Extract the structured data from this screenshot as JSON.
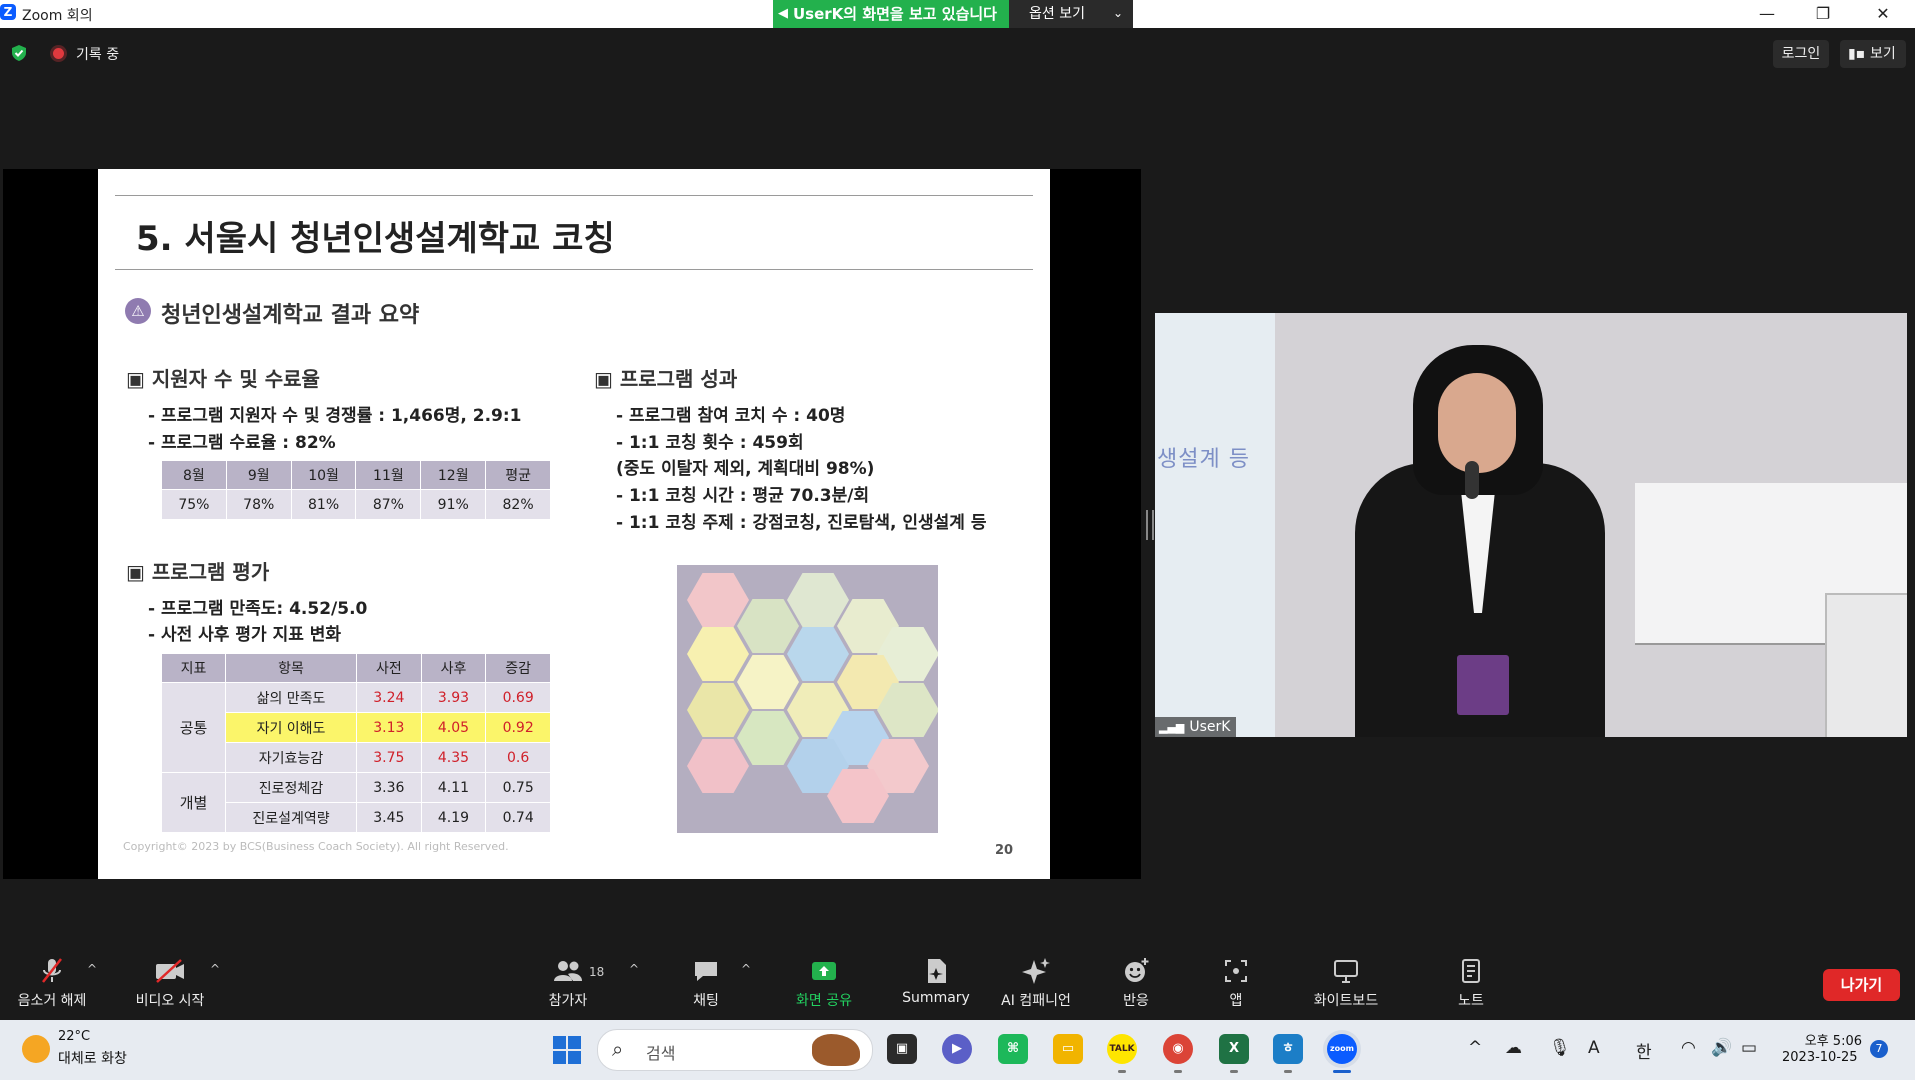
{
  "window": {
    "title": "Zoom 회의",
    "share_banner": "UserK의 화면을 보고 있습니다",
    "view_options": "옵션 보기",
    "controls": [
      "—",
      "❐",
      "✕"
    ]
  },
  "meeting": {
    "recording": "기록 중",
    "login": "로그인",
    "view": "보기"
  },
  "slide": {
    "title": "5. 서울시 청년인생설계학교 코칭",
    "subtitle": "청년인생설계학교 결과 요약",
    "section1": {
      "heading": "▣ 지원자 수 및 수료율",
      "bullets": [
        "- 프로그램 지원자 수 및 경쟁률 : 1,466명, 2.9:1",
        "- 프로그램 수료율 : 82%"
      ],
      "table": {
        "headers": [
          "8월",
          "9월",
          "10월",
          "11월",
          "12월",
          "평균"
        ],
        "values": [
          "75%",
          "78%",
          "81%",
          "87%",
          "91%",
          "82%"
        ]
      }
    },
    "section2": {
      "heading": "▣ 프로그램 성과",
      "bullets": [
        "- 프로그램 참여 코치 수 : 40명",
        "- 1:1 코칭 횟수 : 459회",
        "  (중도 이탈자 제외, 계획대비 98%)",
        "- 1:1 코칭 시간 : 평균 70.3분/회",
        "- 1:1 코칭 주제 : 강점코칭, 진로탐색, 인생설계 등"
      ]
    },
    "section3": {
      "heading": "▣ 프로그램 평가",
      "bullets": [
        "- 프로그램 만족도: 4.52/5.0",
        "- 사전 사후 평가 지표 변화"
      ],
      "table": {
        "headers": [
          "지표",
          "항목",
          "사전",
          "사후",
          "증감"
        ],
        "groups": [
          "공통",
          "개별"
        ],
        "rows": [
          {
            "item": "삶의 만족도",
            "pre": "3.24",
            "post": "3.93",
            "diff": "0.69"
          },
          {
            "item": "자기 이해도",
            "pre": "3.13",
            "post": "4.05",
            "diff": "0.92"
          },
          {
            "item": "자기효능감",
            "pre": "3.75",
            "post": "4.35",
            "diff": "0.6"
          },
          {
            "item": "진로정체감",
            "pre": "3.36",
            "post": "4.11",
            "diff": "0.75"
          },
          {
            "item": "진로설계역량",
            "pre": "3.45",
            "post": "4.19",
            "diff": "0.74"
          }
        ]
      }
    },
    "copyright": "Copyright© 2023 by BCS(Business Coach Society). All right Reserved.",
    "page": "20"
  },
  "video": {
    "name": "UserK",
    "background_sign": "생설계 등"
  },
  "toolbar": {
    "mute": "음소거 해제",
    "video": "비디오 시작",
    "participants": "참가자",
    "participants_count": "18",
    "chat": "채팅",
    "share": "화면 공유",
    "summary": "Summary",
    "ai": "AI 컴패니언",
    "reactions": "반응",
    "apps": "앱",
    "whiteboard": "화이트보드",
    "notes": "노트",
    "leave": "나가기"
  },
  "taskbar": {
    "temp": "22°C",
    "weather": "대체로 화창",
    "search": "검색",
    "ime": "한",
    "font_ic": "A",
    "time": "오후 5:06",
    "date": "2023-10-25",
    "notifications": "7"
  },
  "colors": {
    "zoom_blue": "#0b5cff",
    "share_green": "#23b14d",
    "leave_red": "#e02828",
    "slide_accent": "#8f7bb0",
    "highlight": "#fbf56a"
  }
}
